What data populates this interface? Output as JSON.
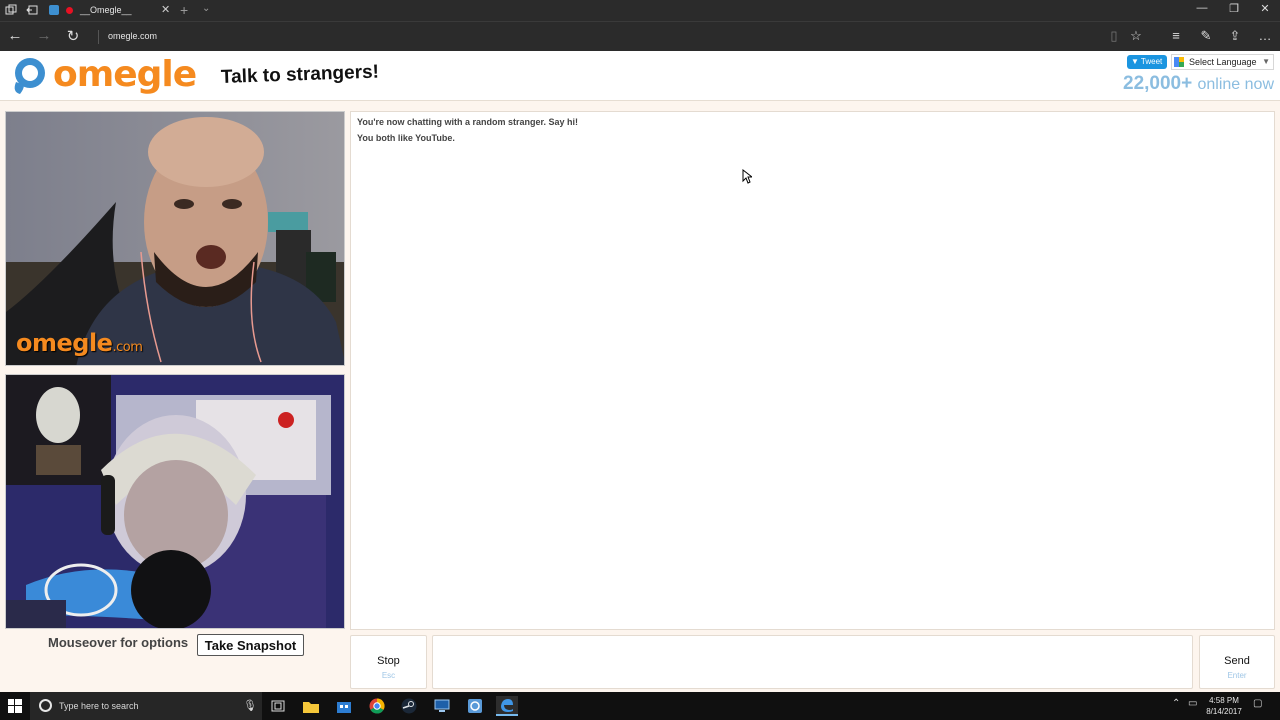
{
  "browser": {
    "tab_title": "__Omegle__",
    "url": "omegle.com",
    "tab_close_glyph": "✕",
    "new_tab_glyph": "+",
    "tab_list_glyph": "⌄",
    "back_glyph": "←",
    "forward_glyph": "→",
    "refresh_glyph": "↻",
    "minimize_glyph": "—",
    "restore_glyph": "❐",
    "close_glyph": "✕",
    "reading_view_glyph": "▯",
    "favorite_glyph": "☆",
    "hub_glyph": "≡",
    "notes_glyph": "✎",
    "share_glyph": "⇪",
    "more_glyph": "…"
  },
  "header": {
    "logo_text": "omegle",
    "tagline": "Talk to strangers!",
    "tweet_label": "Tweet",
    "language_label": "Select Language",
    "online_count": "22,000+",
    "online_label": "online now"
  },
  "video": {
    "watermark": "omegle",
    "watermark_suffix": ".com"
  },
  "controls": {
    "mouseover_text": "Mouseover for options",
    "snapshot_label": "Take Snapshot",
    "stop_label": "Stop",
    "stop_hint": "Esc",
    "send_label": "Send",
    "send_hint": "Enter",
    "message_value": ""
  },
  "chat": {
    "lines": [
      "You're now chatting with a random stranger. Say hi!",
      "You both like YouTube."
    ]
  },
  "taskbar": {
    "search_placeholder": "Type here to search",
    "time": "4:58 PM",
    "date": "8/14/2017",
    "apps": [
      "task-view",
      "file-explorer",
      "store",
      "chrome",
      "steam",
      "app-monitor",
      "app-blue",
      "edge"
    ]
  },
  "colors": {
    "omegle_orange": "#f58a1f",
    "omegle_blue": "#3d8fd0",
    "online_blue": "#8bbde0",
    "page_bg": "#fdf5ee"
  }
}
